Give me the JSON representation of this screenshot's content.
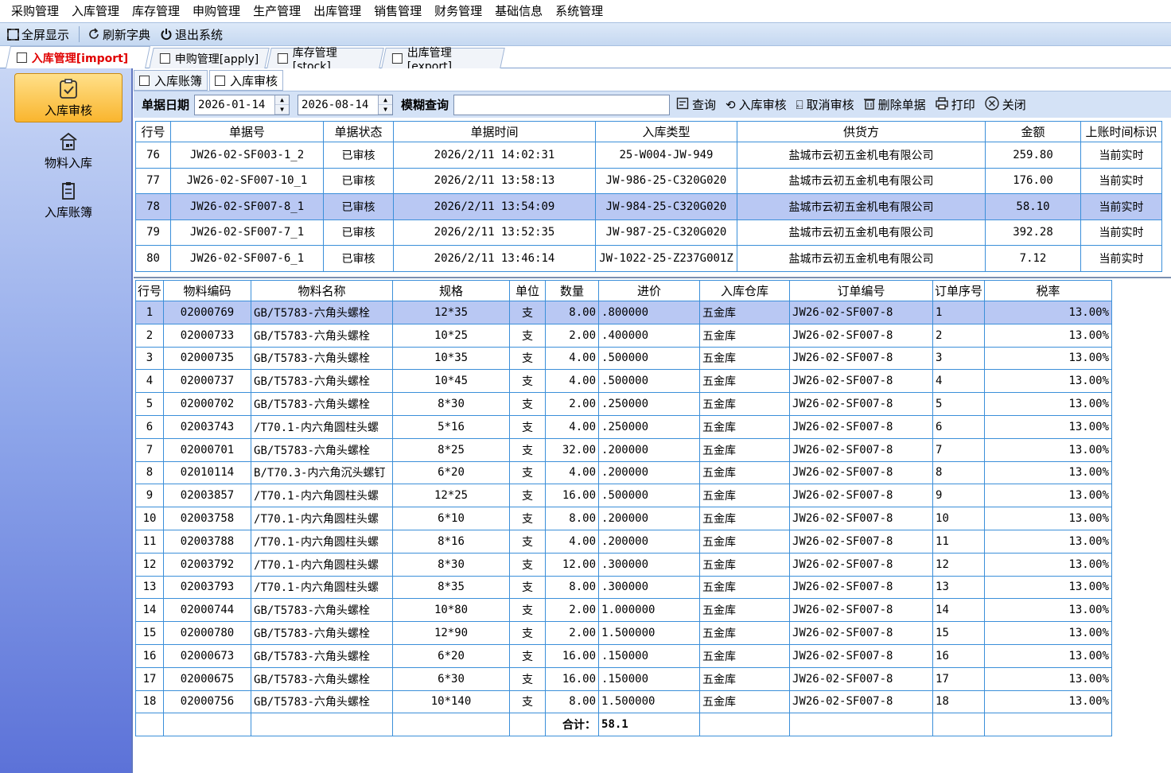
{
  "menu": [
    "采购管理",
    "入库管理",
    "库存管理",
    "申购管理",
    "生产管理",
    "出库管理",
    "销售管理",
    "财务管理",
    "基础信息",
    "系统管理"
  ],
  "toolbar": {
    "fullscreen": "全屏显示",
    "refresh": "刷新字典",
    "exit": "退出系统"
  },
  "tabs": [
    "入库管理[import]",
    "申购管理[apply]",
    "库存管理[stock]",
    "出库管理[export]"
  ],
  "sidebar": [
    "入库审核",
    "物料入库",
    "入库账簿"
  ],
  "subtabs": [
    "入库账簿",
    "入库审核"
  ],
  "filter": {
    "date_label": "单据日期",
    "date_from": "2026-01-14",
    "date_to": "2026-08-14",
    "fuzzy_label": "模糊查询",
    "fuzzy_value": "",
    "query": "查询",
    "audit": "入库审核",
    "unaudit": "取消审核",
    "delete": "删除单据",
    "print": "打印",
    "close": "关闭"
  },
  "master": {
    "headers": [
      "行号",
      "单据号",
      "单据状态",
      "单据时间",
      "入库类型",
      "供货方",
      "金额",
      "上账时间标识"
    ],
    "rows": [
      [
        "76",
        "JW26-02-SF003-1_2",
        "已审核",
        "2026/2/11 14:02:31",
        "25-W004-JW-949",
        "盐城市云初五金机电有限公司",
        "259.80",
        "当前实时"
      ],
      [
        "77",
        "JW26-02-SF007-10_1",
        "已审核",
        "2026/2/11 13:58:13",
        "JW-986-25-C320G020",
        "盐城市云初五金机电有限公司",
        "176.00",
        "当前实时"
      ],
      [
        "78",
        "JW26-02-SF007-8_1",
        "已审核",
        "2026/2/11 13:54:09",
        "JW-984-25-C320G020",
        "盐城市云初五金机电有限公司",
        "58.10",
        "当前实时"
      ],
      [
        "79",
        "JW26-02-SF007-7_1",
        "已审核",
        "2026/2/11 13:52:35",
        "JW-987-25-C320G020",
        "盐城市云初五金机电有限公司",
        "392.28",
        "当前实时"
      ],
      [
        "80",
        "JW26-02-SF007-6_1",
        "已审核",
        "2026/2/11 13:46:14",
        "JW-1022-25-Z237G001Z",
        "盐城市云初五金机电有限公司",
        "7.12",
        "当前实时"
      ]
    ],
    "selected_index": 2
  },
  "detail": {
    "headers": [
      "行号",
      "物料编码",
      "物料名称",
      "规格",
      "单位",
      "数量",
      "进价",
      "入库仓库",
      "订单编号",
      "订单序号",
      "税率"
    ],
    "rows": [
      [
        "1",
        "02000769",
        "GB/T5783-六角头螺栓",
        "12*35",
        "支",
        "8.00",
        ".800000",
        "五金库",
        "JW26-02-SF007-8",
        "1",
        "13.00%"
      ],
      [
        "2",
        "02000733",
        "GB/T5783-六角头螺栓",
        "10*25",
        "支",
        "2.00",
        ".400000",
        "五金库",
        "JW26-02-SF007-8",
        "2",
        "13.00%"
      ],
      [
        "3",
        "02000735",
        "GB/T5783-六角头螺栓",
        "10*35",
        "支",
        "4.00",
        ".500000",
        "五金库",
        "JW26-02-SF007-8",
        "3",
        "13.00%"
      ],
      [
        "4",
        "02000737",
        "GB/T5783-六角头螺栓",
        "10*45",
        "支",
        "4.00",
        ".500000",
        "五金库",
        "JW26-02-SF007-8",
        "4",
        "13.00%"
      ],
      [
        "5",
        "02000702",
        "GB/T5783-六角头螺栓",
        "8*30",
        "支",
        "2.00",
        ".250000",
        "五金库",
        "JW26-02-SF007-8",
        "5",
        "13.00%"
      ],
      [
        "6",
        "02003743",
        "/T70.1-内六角圆柱头螺",
        "5*16",
        "支",
        "4.00",
        ".250000",
        "五金库",
        "JW26-02-SF007-8",
        "6",
        "13.00%"
      ],
      [
        "7",
        "02000701",
        "GB/T5783-六角头螺栓",
        "8*25",
        "支",
        "32.00",
        ".200000",
        "五金库",
        "JW26-02-SF007-8",
        "7",
        "13.00%"
      ],
      [
        "8",
        "02010114",
        "B/T70.3-内六角沉头螺钉",
        "6*20",
        "支",
        "4.00",
        ".200000",
        "五金库",
        "JW26-02-SF007-8",
        "8",
        "13.00%"
      ],
      [
        "9",
        "02003857",
        "/T70.1-内六角圆柱头螺",
        "12*25",
        "支",
        "16.00",
        ".500000",
        "五金库",
        "JW26-02-SF007-8",
        "9",
        "13.00%"
      ],
      [
        "10",
        "02003758",
        "/T70.1-内六角圆柱头螺",
        "6*10",
        "支",
        "8.00",
        ".200000",
        "五金库",
        "JW26-02-SF007-8",
        "10",
        "13.00%"
      ],
      [
        "11",
        "02003788",
        "/T70.1-内六角圆柱头螺",
        "8*16",
        "支",
        "4.00",
        ".200000",
        "五金库",
        "JW26-02-SF007-8",
        "11",
        "13.00%"
      ],
      [
        "12",
        "02003792",
        "/T70.1-内六角圆柱头螺",
        "8*30",
        "支",
        "12.00",
        ".300000",
        "五金库",
        "JW26-02-SF007-8",
        "12",
        "13.00%"
      ],
      [
        "13",
        "02003793",
        "/T70.1-内六角圆柱头螺",
        "8*35",
        "支",
        "8.00",
        ".300000",
        "五金库",
        "JW26-02-SF007-8",
        "13",
        "13.00%"
      ],
      [
        "14",
        "02000744",
        "GB/T5783-六角头螺栓",
        "10*80",
        "支",
        "2.00",
        "1.000000",
        "五金库",
        "JW26-02-SF007-8",
        "14",
        "13.00%"
      ],
      [
        "15",
        "02000780",
        "GB/T5783-六角头螺栓",
        "12*90",
        "支",
        "2.00",
        "1.500000",
        "五金库",
        "JW26-02-SF007-8",
        "15",
        "13.00%"
      ],
      [
        "16",
        "02000673",
        "GB/T5783-六角头螺栓",
        "6*20",
        "支",
        "16.00",
        ".150000",
        "五金库",
        "JW26-02-SF007-8",
        "16",
        "13.00%"
      ],
      [
        "17",
        "02000675",
        "GB/T5783-六角头螺栓",
        "6*30",
        "支",
        "16.00",
        ".150000",
        "五金库",
        "JW26-02-SF007-8",
        "17",
        "13.00%"
      ],
      [
        "18",
        "02000756",
        "GB/T5783-六角头螺栓",
        "10*140",
        "支",
        "8.00",
        "1.500000",
        "五金库",
        "JW26-02-SF007-8",
        "18",
        "13.00%"
      ]
    ],
    "selected_index": 0,
    "total_label": "合计：",
    "total_value": "58.1"
  }
}
